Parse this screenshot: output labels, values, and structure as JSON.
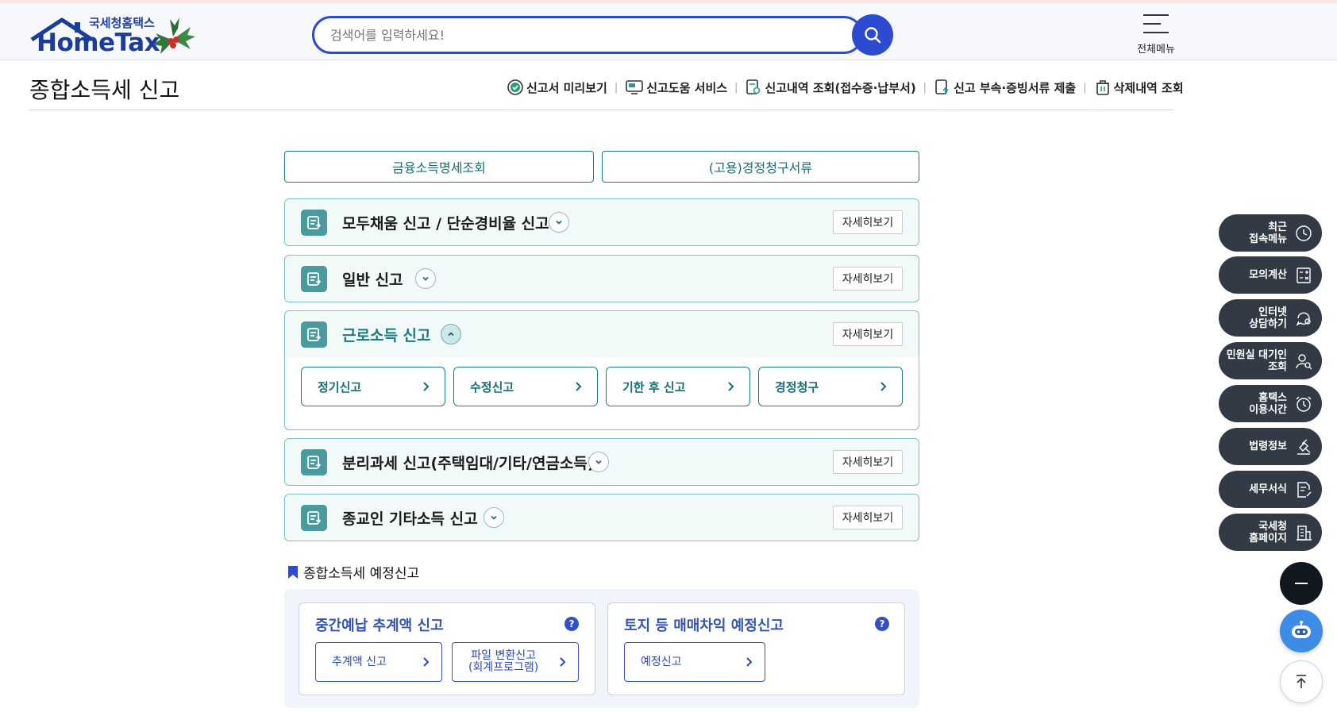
{
  "header": {
    "logo_sub": "국세청홈택스",
    "logo_main": "HomeTax",
    "search_placeholder": "검색어를 입력하세요!",
    "all_menu_label": "전체메뉴"
  },
  "page": {
    "title": "종합소득세 신고",
    "quick_links": [
      {
        "label": "신고서 미리보기",
        "icon": "check-circle-icon"
      },
      {
        "label": "신고도움 서비스",
        "icon": "monitor-icon"
      },
      {
        "label": "신고내역 조회(접수증·납부서)",
        "icon": "document-search-icon"
      },
      {
        "label": "신고 부속·증빙서류 제출",
        "icon": "upload-document-icon"
      },
      {
        "label": "삭제내역 조회",
        "icon": "trash-icon"
      }
    ]
  },
  "top_buttons": [
    "금융소득명세조회",
    "(고용)경정청구서류"
  ],
  "panels": [
    {
      "title": "모두채움 신고 / 단순경비율 신고",
      "detail": "자세히보기",
      "expanded": false
    },
    {
      "title": "일반 신고",
      "detail": "자세히보기",
      "expanded": false
    },
    {
      "title": "근로소득 신고",
      "detail": "자세히보기",
      "expanded": true,
      "sub_buttons": [
        "정기신고",
        "수정신고",
        "기한 후 신고",
        "경정청구"
      ]
    },
    {
      "title": "분리과세 신고(주택임대/기타/연금소득)",
      "detail": "자세히보기",
      "expanded": false
    },
    {
      "title": "종교인 기타소득 신고",
      "detail": "자세히보기",
      "expanded": false
    }
  ],
  "prepayment": {
    "section_title": "종합소득세 예정신고",
    "cards": [
      {
        "title": "중간예납 추계액 신고",
        "buttons": [
          "추계액 신고",
          "파일 변환신고\n(회계프로그램)"
        ]
      },
      {
        "title": "토지 등 매매차익 예정신고",
        "buttons": [
          "예정신고"
        ]
      }
    ]
  },
  "float_menu": [
    {
      "label": "최근\n접속메뉴",
      "icon": "clock-icon"
    },
    {
      "label": "모의계산",
      "icon": "calculator-icon"
    },
    {
      "label": "인터넷\n상담하기",
      "icon": "chat-icon"
    },
    {
      "label": "민원실 대기인\n조회",
      "icon": "person-search-icon"
    },
    {
      "label": "홈택스\n이용시간",
      "icon": "alarm-clock-icon"
    },
    {
      "label": "법령정보",
      "icon": "gavel-icon"
    },
    {
      "label": "세무서식",
      "icon": "form-edit-icon"
    },
    {
      "label": "국세청\n홈페이지",
      "icon": "building-icon"
    }
  ],
  "colors": {
    "accent_blue": "#2d4bd0",
    "teal": "#1b7f86",
    "dark_float": "#323a45",
    "chatbot": "#3f8ce6"
  }
}
